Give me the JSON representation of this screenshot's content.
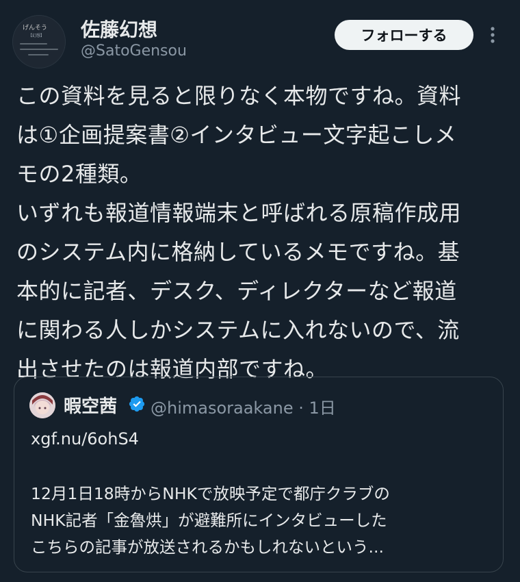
{
  "author": {
    "display_name": "佐藤幻想",
    "handle": "@SatoGensou",
    "avatar_text": {
      "title": "げんそう",
      "subtitle": "【幻想】"
    }
  },
  "follow_button_label": "フォローする",
  "more_icon": "more-vertical-icon",
  "tweet_text": "この資料を見ると限りなく本物ですね。資料\nは①企画提案書②インタビュー文字起こしメ\nモの2種類。\nいずれも報道情報端末と呼ばれる原稿作成用\nのシステム内に格納しているメモですね。基\n本的に記者、デスク、ディレクターなど報道\nに関わる人しかシステムに入れないので、流\n出させたのは報道内部ですね。",
  "quote": {
    "display_name": "暇空茜",
    "verified": true,
    "handle_and_time": "@himasoraakane · 1日",
    "link": "xgf.nu/6ohS4",
    "body": "12月1日18時からNHKで放映予定で都庁クラブの\nNHK記者「金魯烘」が避難所にインタビューした\nこちらの記事が放送されるかもしれないという..."
  },
  "colors": {
    "background": "#15202b",
    "text": "#e7e9ea",
    "secondary_text": "#8b98a5",
    "verified_blue": "#1d9bf0",
    "card_border": "#38444d"
  }
}
